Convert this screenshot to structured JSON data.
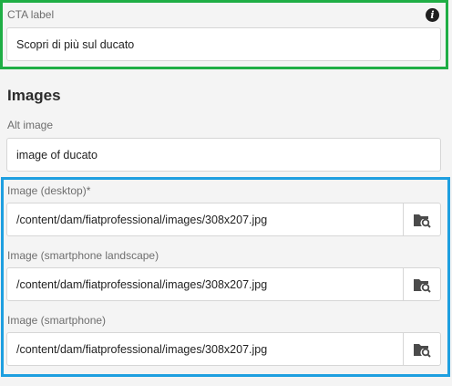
{
  "cta": {
    "label": "CTA label",
    "value": "Scopri di più sul ducato",
    "info_icon": "info-icon"
  },
  "images_section": {
    "title": "Images",
    "alt": {
      "label": "Alt image",
      "value": "image of ducato"
    },
    "fields": [
      {
        "label": "Image (desktop)*",
        "value": "/content/dam/fiatprofessional/images/308x207.jpg",
        "icon": "folder-search-icon"
      },
      {
        "label": "Image (smartphone landscape)",
        "value": "/content/dam/fiatprofessional/images/308x207.jpg",
        "icon": "folder-search-icon"
      },
      {
        "label": "Image (smartphone)",
        "value": "/content/dam/fiatprofessional/images/308x207.jpg",
        "icon": "folder-search-icon"
      }
    ]
  },
  "highlights": {
    "cta_box_color": "#1fae45",
    "images_box_color": "#1e9fe0"
  }
}
